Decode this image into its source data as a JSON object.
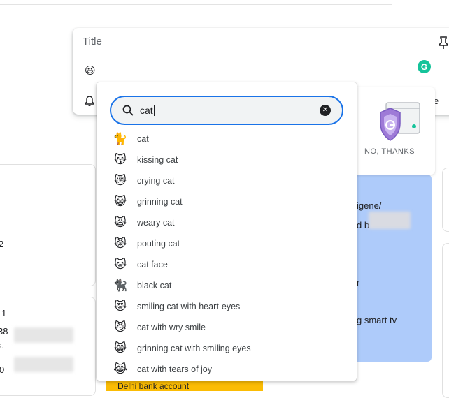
{
  "editor": {
    "title_placeholder": "Title",
    "body_emoji": "😃",
    "close_fragment": "e"
  },
  "grammarly": {
    "badge_letter": "G",
    "no_thanks_label": "NO, THANKS"
  },
  "background": {
    "left_text_1": "2",
    "left_text_2": "1",
    "left_text_3": "38",
    "left_text_4": "s.",
    "left_text_5": "0",
    "blue_text_1": "igene/",
    "blue_text_2": "d b",
    "blue_text_3": "r",
    "blue_text_4": "g smart tv",
    "yellow_text": "Delhi bank account"
  },
  "emoji_picker": {
    "search_value": "cat",
    "clear_symbol": "✕",
    "results": [
      {
        "emoji": "🐈",
        "label": "cat"
      },
      {
        "emoji": "😽",
        "label": "kissing cat"
      },
      {
        "emoji": "😿",
        "label": "crying cat"
      },
      {
        "emoji": "😺",
        "label": "grinning cat"
      },
      {
        "emoji": "🙀",
        "label": "weary cat"
      },
      {
        "emoji": "😾",
        "label": "pouting cat"
      },
      {
        "emoji": "🐱",
        "label": "cat face"
      },
      {
        "emoji": "🐈‍⬛",
        "label": "black cat"
      },
      {
        "emoji": "😻",
        "label": "smiling cat with heart-eyes"
      },
      {
        "emoji": "😼",
        "label": "cat with wry smile"
      },
      {
        "emoji": "😸",
        "label": "grinning cat with smiling eyes"
      },
      {
        "emoji": "😹",
        "label": "cat with tears of joy"
      }
    ]
  },
  "colors": {
    "accent": "#1a73e8",
    "note_blue": "#aecbfa",
    "note_yellow": "#fbbc04",
    "grammarly_green": "#15c39a",
    "shield_purple": "#9e7ad7"
  },
  "icons": [
    "pin-icon",
    "bell-icon",
    "search-icon",
    "clear-icon",
    "grammarly-icon",
    "shield-icon"
  ]
}
